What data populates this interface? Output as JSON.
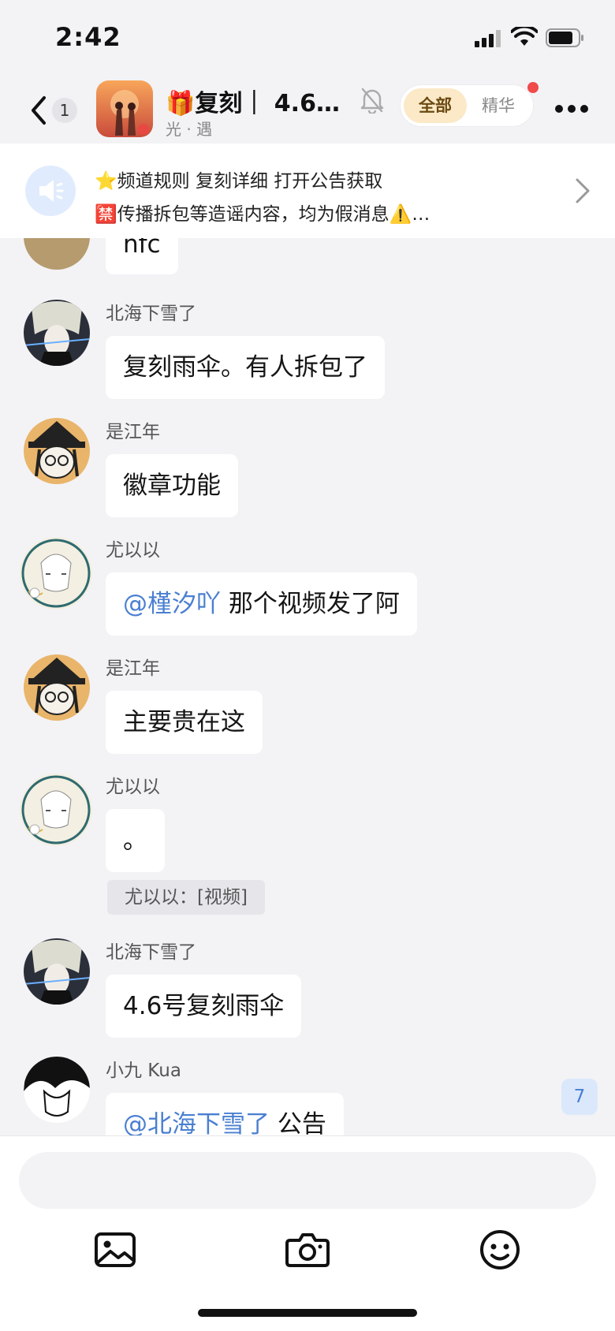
{
  "status_bar": {
    "time": "2:42"
  },
  "header": {
    "back_count": "1",
    "channel_title": "🎁复刻｜ 4.6…",
    "channel_subtitle": "光 · 遇",
    "tabs": [
      {
        "label": "全部",
        "active": true
      },
      {
        "label": "精华",
        "active": false
      }
    ]
  },
  "announcement": {
    "line1": "⭐频道规则 复刻详细 打开公告获取",
    "line2": "🈲传播拆包等造谣内容，均为假消息⚠️…"
  },
  "messages": [
    {
      "user": "",
      "text": "nfc"
    },
    {
      "user": "北海下雪了",
      "text": "复刻雨伞。有人拆包了"
    },
    {
      "user": "是江年",
      "text": "徽章功能"
    },
    {
      "user": "尤以以",
      "mention": "@槿汐吖",
      "text": " 那个视频发了阿"
    },
    {
      "user": "是江年",
      "text": "主要贵在这"
    },
    {
      "user": "尤以以",
      "text": "。",
      "quote": "尤以以：[视频]"
    },
    {
      "user": "北海下雪了",
      "text": "4.6号复刻雨伞"
    },
    {
      "user": "小九 Kua",
      "mention": "@北海下雪了",
      "text": " 公告"
    }
  ],
  "unread_badge": "7",
  "input": {
    "placeholder": ""
  },
  "toolbar": {
    "icons": [
      "image-icon",
      "camera-icon",
      "emoji-icon"
    ]
  },
  "colors": {
    "mention": "#4a7fd1",
    "active_tab_bg": "#fbe9c7",
    "badge_dot": "#f04a4a"
  }
}
